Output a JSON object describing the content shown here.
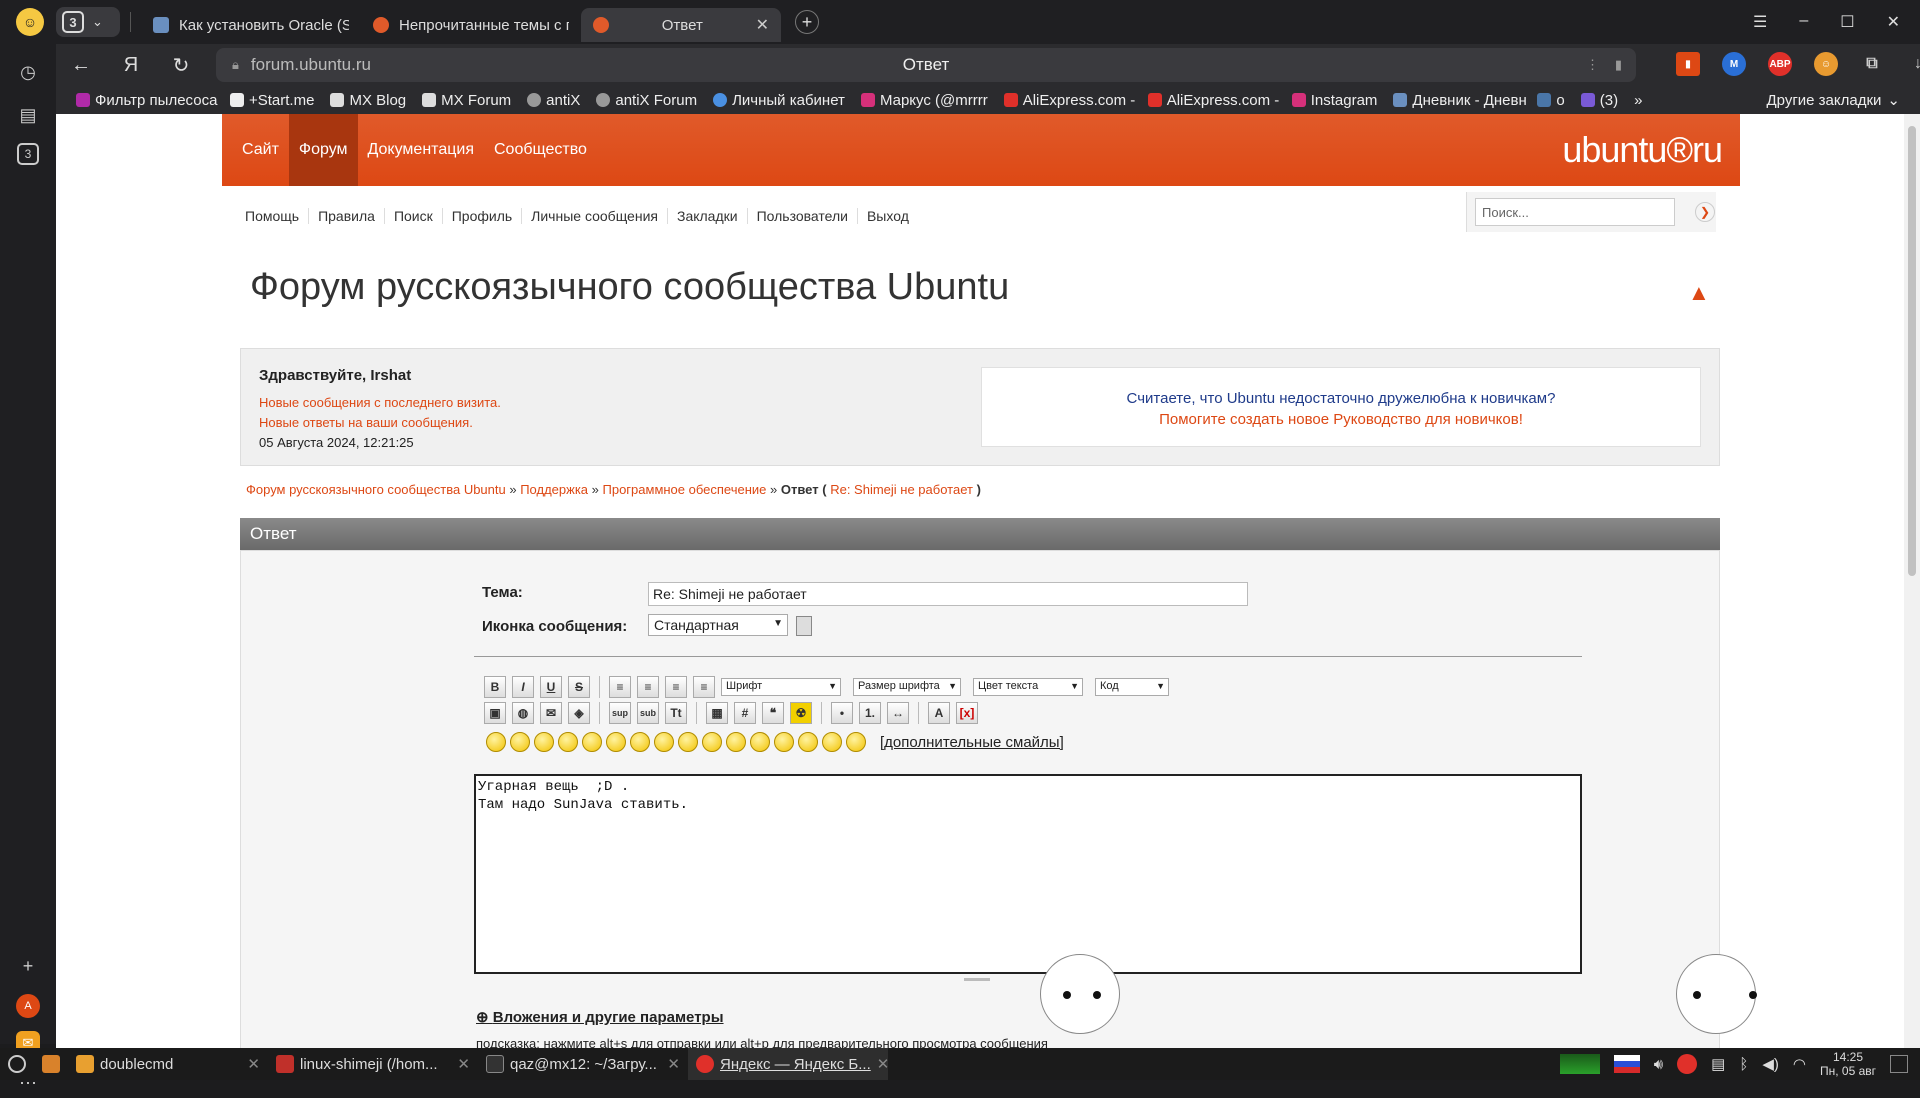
{
  "browser": {
    "tab_count": "3",
    "tabs": [
      {
        "title": "Как установить Oracle (Su",
        "active": false
      },
      {
        "title": "Непрочитанные темы с по",
        "active": false
      },
      {
        "title": "Ответ",
        "active": true
      }
    ],
    "url_host": "forum.ubuntu.ru",
    "page_title": "Ответ",
    "bookmarks": [
      "Фильтр пылесоса",
      "+Start.me",
      "MX Blog",
      "MX Forum",
      "antiX",
      "antiX Forum",
      "Личный кабинет",
      "Маркус (@mrrrr",
      "AliExpress.com - и",
      "AliExpress.com - и",
      "Instagram",
      "Дневник - Дневн",
      "о",
      "(3)"
    ],
    "other_bookmarks": "Другие закладки",
    "sidebar_badge": "3"
  },
  "site": {
    "topnav": [
      "Сайт",
      "Форум",
      "Документация",
      "Сообщество"
    ],
    "logo": "ubuntu®ru",
    "subnav": [
      "Помощь",
      "Правила",
      "Поиск",
      "Профиль",
      "Личные сообщения",
      "Закладки",
      "Пользователи",
      "Выход"
    ],
    "search_placeholder": "Поиск...",
    "title": "Форум русскоязычного сообщества Ubuntu"
  },
  "info": {
    "greeting": "Здравствуйте, Irshat",
    "new_since": "Новые сообщения с последнего визита.",
    "new_replies": "Новые ответы на ваши сообщения.",
    "datetime": "05 Августа 2024, 12:21:25",
    "promo_line1": "Считаете, что Ubuntu недостаточно дружелюбна к новичкам?",
    "promo_line2": "Помогите создать новое Руководство для новичков!"
  },
  "breadcrumb": {
    "c1": "Форум русскоязычного сообщества Ubuntu",
    "c2": "Поддержка",
    "c3": "Программное обеспечение",
    "current": "Ответ",
    "topic": "Re: Shimeji не работает"
  },
  "form": {
    "header": "Ответ",
    "subject_label": "Тема:",
    "subject_value": "Re: Shimeji не работает",
    "icon_label": "Иконка сообщения:",
    "icon_value": "Стандартная",
    "font_select": "Шрифт",
    "size_select": "Размер шрифта",
    "color_select": "Цвет текста",
    "code_select": "Код",
    "more_smileys": "[дополнительные смайлы]",
    "message": "Угарная вещь  ;D .\nТам надо SunJava ставить.\n",
    "attachments": "Вложения и другие параметры",
    "hint": "подсказка: нажмите alt+s для отправки или alt+p для предварительного просмотра сообщения"
  },
  "taskbar": {
    "items": [
      {
        "label": "doublecmd"
      },
      {
        "label": "linux-shimeji (/hom..."
      },
      {
        "label": "qaz@mx12: ~/Загру..."
      },
      {
        "label": "Яндекс — Яндекс Б..."
      }
    ],
    "time": "14:25",
    "date": "Пн, 05 авг"
  },
  "colors": {
    "accent": "#dd4814",
    "link_blue": "#1f3b8a"
  }
}
